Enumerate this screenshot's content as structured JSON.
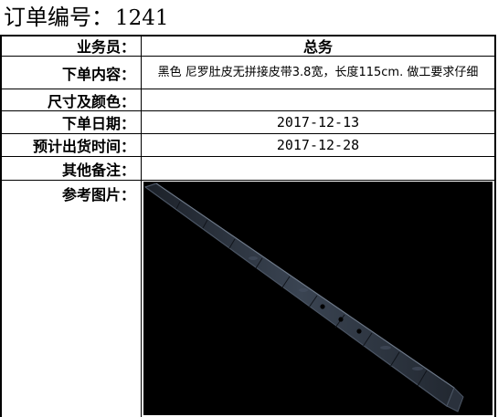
{
  "order": {
    "title_label": "订单编号：",
    "number": "1241"
  },
  "rows": {
    "salesperson": {
      "label": "业务员：",
      "value": "总务"
    },
    "content": {
      "label": "下单内容：",
      "value": "黑色 尼罗肚皮无拼接皮带3.8宽，长度115cm. 做工要求仔细"
    },
    "size_color": {
      "label": "尺寸及颜色：",
      "value": ""
    },
    "order_date": {
      "label": "下单日期：",
      "value": "2017-12-13"
    },
    "ship_date": {
      "label": "预计出货时间：",
      "value": "2017-12-28"
    },
    "notes": {
      "label": "其他备注：",
      "value": ""
    },
    "reference": {
      "label": "参考图片："
    }
  },
  "photo": {
    "icon": "belt-photo",
    "background": "#000000",
    "belt_color": "#2b3340"
  }
}
